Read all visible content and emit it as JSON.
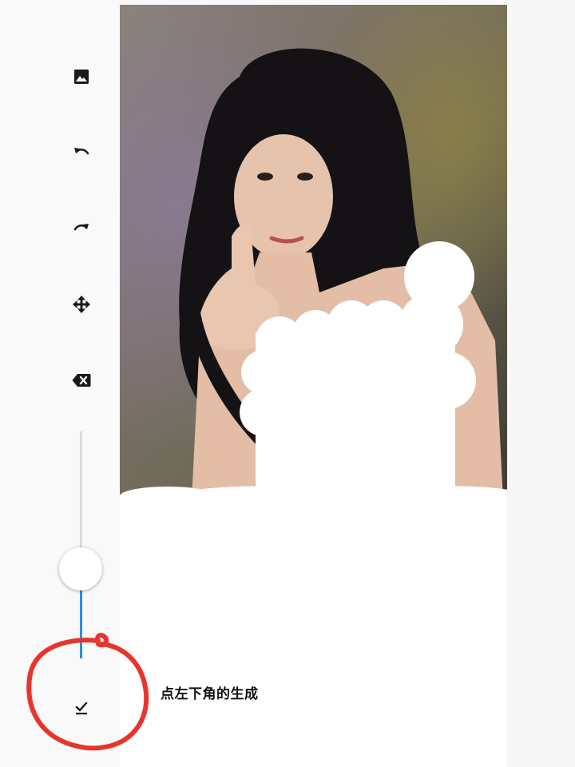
{
  "toolbar": {
    "tools": [
      {
        "name": "image-icon"
      },
      {
        "name": "undo-icon"
      },
      {
        "name": "redo-icon"
      },
      {
        "name": "move-icon"
      },
      {
        "name": "clear-icon"
      }
    ],
    "slider": {
      "level": 0.33
    },
    "confirm": {
      "icon": "check-icon"
    }
  },
  "canvas": {
    "hint": "点左下角的生成"
  },
  "annotation": {
    "color": "#e8342c"
  }
}
